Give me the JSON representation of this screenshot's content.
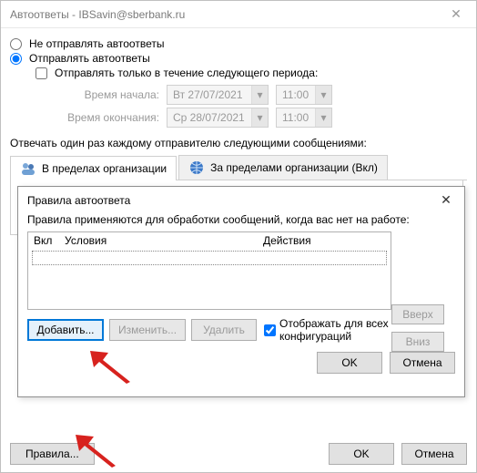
{
  "window": {
    "title": "Автоответы - IBSavin@sberbank.ru"
  },
  "radios": {
    "dont_send": "Не отправлять автоответы",
    "send": "Отправлять автоответы"
  },
  "period": {
    "checkbox_label": "Отправлять только в течение следующего периода:",
    "start_label": "Время начала:",
    "end_label": "Время окончания:",
    "start_date": "Вт 27/07/2021",
    "end_date": "Ср 28/07/2021",
    "start_time": "11:00",
    "end_time": "11:00"
  },
  "reply_label": "Отвечать один раз каждому отправителю следующими сообщениями:",
  "tabs": {
    "inside": "В пределах организации",
    "outside": "За пределами организации (Вкл)"
  },
  "bottom": {
    "rules_button": "Правила...",
    "ok": "OK",
    "cancel": "Отмена"
  },
  "modal": {
    "title": "Правила автоответа",
    "desc": "Правила применяются для обработки сообщений, когда вас нет на работе:",
    "col_enabled": "Вкл",
    "col_conditions": "Условия",
    "col_actions": "Действия",
    "up": "Вверх",
    "down": "Вниз",
    "add": "Добавить...",
    "edit": "Изменить...",
    "delete": "Удалить",
    "show_all": "Отображать для всех конфигураций",
    "ok": "OK",
    "cancel": "Отмена"
  }
}
